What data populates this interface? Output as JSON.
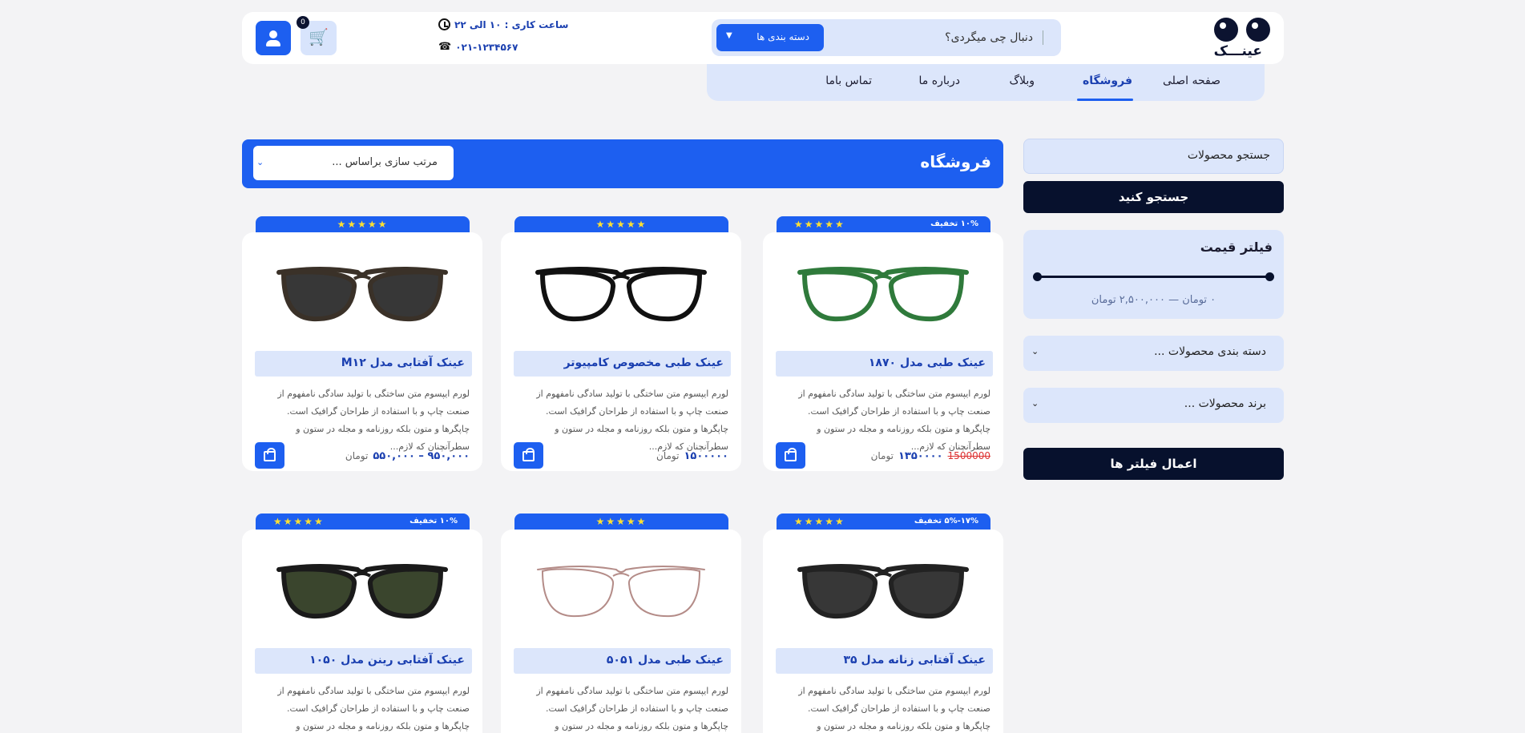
{
  "header": {
    "logo_text": "عینـــک",
    "search_placeholder": "دنبال چی میگردی؟",
    "category_button": "دسته بندی ها",
    "work_hours": "ساعت کاری : ۱۰ الی ۲۲",
    "phone": "۰۲۱-۱۲۳۴۵۶۷",
    "cart_count": "0"
  },
  "nav": {
    "items": [
      {
        "label": "صفحه اصلی"
      },
      {
        "label": "فروشگاه"
      },
      {
        "label": "وبلاگ"
      },
      {
        "label": "درباره ما"
      },
      {
        "label": "تماس باما"
      }
    ],
    "active": "فروشگاه"
  },
  "sidebar": {
    "search_label": "جستجو محصولات",
    "search_button": "جستجو کنید",
    "price_filter_title": "فیلتر قیمت",
    "price_range_text": "۰ تومان — ۲,۵۰۰,۰۰۰ تومان",
    "category_dropdown": "دسته بندی محصولات ...",
    "brand_dropdown": "برند محصولات ...",
    "apply_button": "اعمال فیلتر ها"
  },
  "shop": {
    "title": "فروشگاه",
    "sort_placeholder": "مرتب سازی براساس ..."
  },
  "products": [
    {
      "name": "عینک طبی مدل ۱۸۷۰",
      "badge": "۱۰% تخفیف",
      "stars": "★★★★★",
      "desc": "لورم ایپسوم متن ساختگی با تولید سادگی نامفهوم از صنعت چاپ و با استفاده از طراحان گرافیک است. چاپگرها و متون بلکه روزنامه و مجله در ستون و سطرآنچنان که لازم...",
      "old_price": "1500000",
      "price": "۱۳۵۰۰۰۰",
      "unit": "تومان",
      "frame_color": "#2f7a3b"
    },
    {
      "name": "عینک طبی مخصوص کامپیوتر",
      "badge": "",
      "stars": "★★★★★",
      "desc": "لورم ایپسوم متن ساختگی با تولید سادگی نامفهوم از صنعت چاپ و با استفاده از طراحان گرافیک است. چاپگرها و متون بلکه روزنامه و مجله در ستون و سطرآنچنان که لازم...",
      "old_price": "",
      "price": "۱۵۰۰۰۰۰",
      "unit": "تومان",
      "frame_color": "#111111"
    },
    {
      "name": "عینک آفتابی مدل M۱۲",
      "badge": "",
      "stars": "★★★★★",
      "desc": "لورم ایپسوم متن ساختگی با تولید سادگی نامفهوم از صنعت چاپ و با استفاده از طراحان گرافیک است. چاپگرها و متون بلکه روزنامه و مجله در ستون و سطرآنچنان که لازم...",
      "old_price": "",
      "price": "۹۵۰,۰۰۰ – ۵۵۰,۰۰۰",
      "unit": "تومان",
      "frame_color": "#3a3128"
    },
    {
      "name": "عینک آفتابی زنانه مدل ۳۵",
      "badge": "۱۷%-۵% تخفیف",
      "stars": "★★★★★",
      "desc": "لورم ایپسوم متن ساختگی با تولید سادگی نامفهوم از صنعت چاپ و با استفاده از طراحان گرافیک است. چاپگرها و متون بلکه روزنامه و مجله در ستون و سطرآنچنان که لازم...",
      "old_price": "",
      "price": "",
      "unit": "",
      "frame_color": "#222222"
    },
    {
      "name": "عینک طبی مدل ۵۰۵۱",
      "badge": "",
      "stars": "★★★★★",
      "desc": "لورم ایپسوم متن ساختگی با تولید سادگی نامفهوم از صنعت چاپ و با استفاده از طراحان گرافیک است. چاپگرها و متون بلکه روزنامه و مجله در ستون و سطرآنچنان که لازم...",
      "old_price": "",
      "price": "",
      "unit": "",
      "frame_color": "#b48c88"
    },
    {
      "name": "عینک آفتابی رینن مدل ۱۰۵۰",
      "badge": "۱۰% تخفیف",
      "stars": "★★★★★",
      "desc": "لورم ایپسوم متن ساختگی با تولید سادگی نامفهوم از صنعت چاپ و با استفاده از طراحان گرافیک است. چاپگرها و متون بلکه روزنامه و مجله در ستون و سطرآنچنان که لازم...",
      "old_price": "",
      "price": "",
      "unit": "",
      "frame_color": "#1a1a1a"
    }
  ],
  "colors": {
    "accent": "#1d5ff0",
    "dark": "#07112d",
    "light": "#dce6fb"
  }
}
